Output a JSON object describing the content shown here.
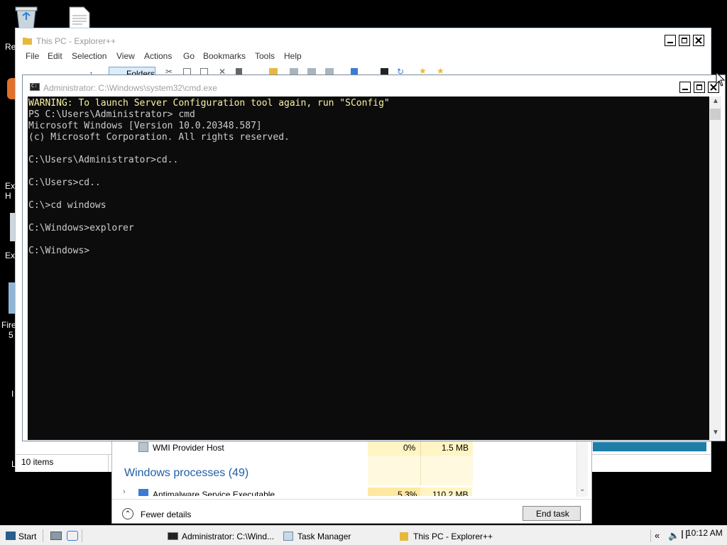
{
  "desktop": {
    "icons": [
      {
        "name": "recycle-bin",
        "label": "Re"
      },
      {
        "name": "document",
        "label": ""
      },
      {
        "name": "app-1",
        "label": "Ex\nH"
      },
      {
        "name": "app-2",
        "label": "Ex"
      },
      {
        "name": "firefox",
        "label": "Fire\n5"
      }
    ]
  },
  "explorer": {
    "title": "This PC - Explorer++",
    "menu": [
      "File",
      "Edit",
      "Selection",
      "View",
      "Actions",
      "Go",
      "Bookmarks",
      "Tools",
      "Help"
    ],
    "folders_label": "Folders",
    "status_items": "10 items"
  },
  "task_manager": {
    "process_name": "WMI Provider Host",
    "process_cpu": "0%",
    "process_mem": "1.5 MB",
    "group_header": "Windows processes (49)",
    "partial_process": "Antimalware Service Executable",
    "partial_cpu": "5.3%",
    "partial_mem": "110.2 MB",
    "fewer_details": "Fewer details",
    "end_task": "End task"
  },
  "cmd": {
    "title": "Administrator: C:\\Windows\\system32\\cmd.exe",
    "lines": [
      "WARNING: To launch Server Configuration tool again, run \"SConfig\"",
      "PS C:\\Users\\Administrator> cmd",
      "Microsoft Windows [Version 10.0.20348.587]",
      "(c) Microsoft Corporation. All rights reserved.",
      "",
      "C:\\Users\\Administrator>cd..",
      "",
      "C:\\Users>cd..",
      "",
      "C:\\>cd windows",
      "",
      "C:\\Windows>explorer",
      "",
      "C:\\Windows>"
    ]
  },
  "taskbar": {
    "start": "Start",
    "buttons": [
      {
        "label": "Administrator: C:\\Wind...",
        "icon": "cmd-icon"
      },
      {
        "label": "Task Manager",
        "icon": "task-manager-icon"
      },
      {
        "label": "This PC - Explorer++",
        "icon": "folder-icon"
      }
    ],
    "clock": "10:12 AM"
  }
}
